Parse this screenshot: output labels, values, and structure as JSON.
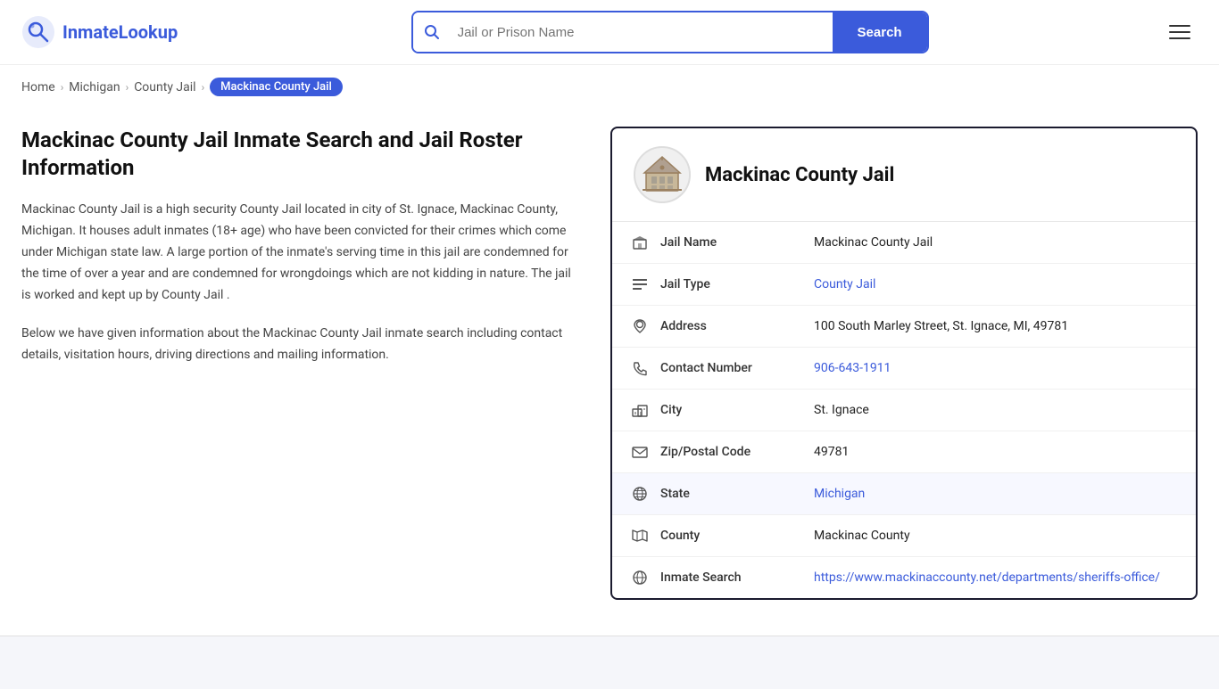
{
  "header": {
    "logo_text_prefix": "Inmate",
    "logo_text_suffix": "Lookup",
    "search_placeholder": "Jail or Prison Name",
    "search_button_label": "Search"
  },
  "breadcrumb": {
    "items": [
      {
        "label": "Home",
        "href": "#"
      },
      {
        "label": "Michigan",
        "href": "#"
      },
      {
        "label": "County Jail",
        "href": "#"
      },
      {
        "label": "Mackinac County Jail",
        "current": true
      }
    ]
  },
  "left": {
    "title": "Mackinac County Jail Inmate Search and Jail Roster Information",
    "desc1": "Mackinac County Jail is a high security County Jail located in city of St. Ignace, Mackinac County, Michigan. It houses adult inmates (18+ age) who have been convicted for their crimes which come under Michigan state law. A large portion of the inmate's serving time in this jail are condemned for the time of over a year and are condemned for wrongdoings which are not kidding in nature. The jail is worked and kept up by County Jail .",
    "desc2": "Below we have given information about the Mackinac County Jail inmate search including contact details, visitation hours, driving directions and mailing information."
  },
  "card": {
    "title": "Mackinac County Jail",
    "rows": [
      {
        "id": "jail-name",
        "icon": "building",
        "label": "Jail Name",
        "value": "Mackinac County Jail",
        "link": false,
        "highlighted": false
      },
      {
        "id": "jail-type",
        "icon": "list",
        "label": "Jail Type",
        "value": "County Jail",
        "link": true,
        "link_href": "#",
        "highlighted": false
      },
      {
        "id": "address",
        "icon": "pin",
        "label": "Address",
        "value": "100 South Marley Street, St. Ignace, MI, 49781",
        "link": false,
        "highlighted": false
      },
      {
        "id": "contact",
        "icon": "phone",
        "label": "Contact Number",
        "value": "906-643-1911",
        "link": true,
        "link_href": "tel:906-643-1911",
        "highlighted": false
      },
      {
        "id": "city",
        "icon": "city",
        "label": "City",
        "value": "St. Ignace",
        "link": false,
        "highlighted": false
      },
      {
        "id": "zip",
        "icon": "mail",
        "label": "Zip/Postal Code",
        "value": "49781",
        "link": false,
        "highlighted": false
      },
      {
        "id": "state",
        "icon": "globe",
        "label": "State",
        "value": "Michigan",
        "link": true,
        "link_href": "#",
        "highlighted": true
      },
      {
        "id": "county",
        "icon": "map",
        "label": "County",
        "value": "Mackinac County",
        "link": false,
        "highlighted": false
      },
      {
        "id": "inmate-search",
        "icon": "globe2",
        "label": "Inmate Search",
        "value": "https://www.mackinaccounty.net/departments/sheriffs-office/",
        "link": true,
        "link_href": "https://www.mackinaccounty.net/departments/sheriffs-office/",
        "highlighted": false
      }
    ]
  }
}
